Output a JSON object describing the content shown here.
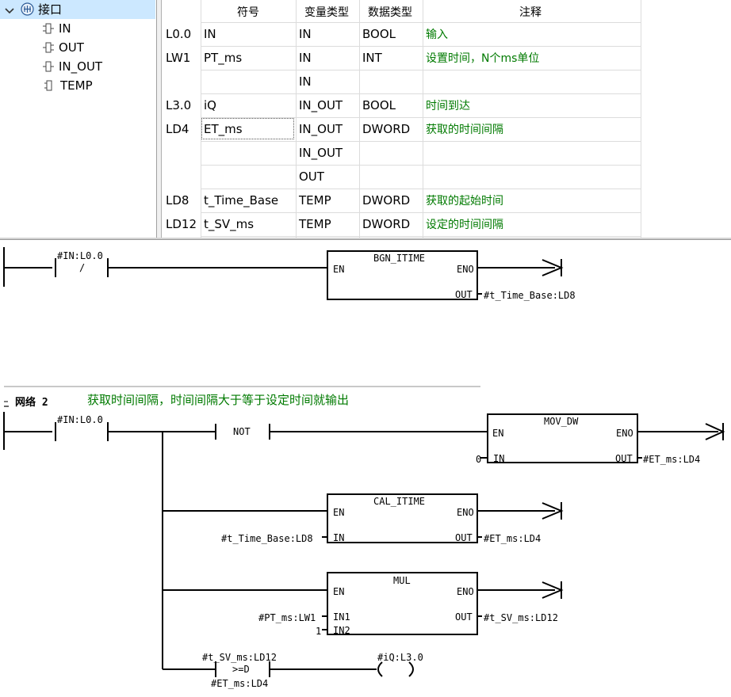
{
  "tree": {
    "root": "接口",
    "items": [
      "IN",
      "OUT",
      "IN_OUT",
      "TEMP"
    ]
  },
  "table": {
    "headers": [
      "符号",
      "变量类型",
      "数据类型",
      "注释"
    ],
    "rows": [
      {
        "addr": "L0.0",
        "symbol": "IN",
        "vartype": "IN",
        "datatype": "BOOL",
        "comment": "输入"
      },
      {
        "addr": "LW1",
        "symbol": "PT_ms",
        "vartype": "IN",
        "datatype": "INT",
        "comment": "设置时间，N个ms单位"
      },
      {
        "addr": "",
        "symbol": "",
        "vartype": "IN",
        "datatype": "",
        "comment": ""
      },
      {
        "addr": "L3.0",
        "symbol": "iQ",
        "vartype": "IN_OUT",
        "datatype": "BOOL",
        "comment": "时间到达"
      },
      {
        "addr": "LD4",
        "symbol": "ET_ms",
        "vartype": "IN_OUT",
        "datatype": "DWORD",
        "comment": "获取的时间间隔"
      },
      {
        "addr": "",
        "symbol": "",
        "vartype": "IN_OUT",
        "datatype": "",
        "comment": ""
      },
      {
        "addr": "",
        "symbol": "",
        "vartype": "OUT",
        "datatype": "",
        "comment": ""
      },
      {
        "addr": "LD8",
        "symbol": "t_Time_Base",
        "vartype": "TEMP",
        "datatype": "DWORD",
        "comment": "获取的起始时间"
      },
      {
        "addr": "LD12",
        "symbol": "t_SV_ms",
        "vartype": "TEMP",
        "datatype": "DWORD",
        "comment": "设定的时间间隔"
      }
    ]
  },
  "network1": {
    "contact_label": "#IN:L0.0",
    "contact_mark": "/",
    "box_title": "BGN_ITIME",
    "en": "EN",
    "eno": "ENO",
    "out": "OUT",
    "out_label": "#t_Time_Base:LD8"
  },
  "network2": {
    "title": "网络 2",
    "comment": "获取时间间隔，时间间隔大于等于设定时间就输出",
    "contact_label": "#IN:L0.0",
    "not_label": "NOT",
    "mov": {
      "title": "MOV_DW",
      "en": "EN",
      "eno": "ENO",
      "in": "IN",
      "out": "OUT",
      "in_label": "0",
      "out_label": "#ET_ms:LD4"
    },
    "cal": {
      "title": "CAL_ITIME",
      "en": "EN",
      "eno": "ENO",
      "in": "IN",
      "out": "OUT",
      "in_label": "#t_Time_Base:LD8",
      "out_label": "#ET_ms:LD4"
    },
    "mul": {
      "title": "MUL",
      "en": "EN",
      "eno": "ENO",
      "in1": "IN1",
      "in2": "IN2",
      "out": "OUT",
      "in1_label": "#PT_ms:LW1",
      "in2_label": "1",
      "out_label": "#t_SV_ms:LD12"
    },
    "cmp": {
      "top_label": "#t_SV_ms:LD12",
      "op": ">=D",
      "bottom_label": "#ET_ms:LD4"
    },
    "coil_label": "#iQ:L3.0"
  }
}
